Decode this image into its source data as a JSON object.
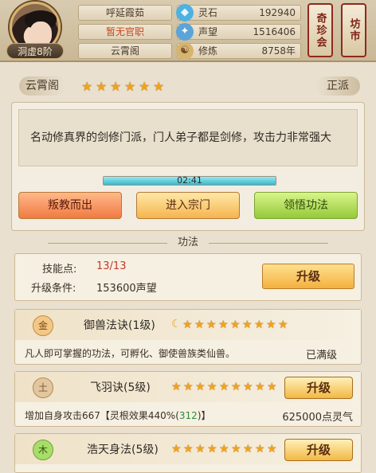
{
  "player": {
    "avatar_icon": "cultivator-avatar",
    "realm": "洞虚8阶",
    "name": "呼延霞茹",
    "official_title": "暂无官职",
    "sect": "云霄阁"
  },
  "resources": [
    {
      "icon": "spirit-stone-icon",
      "label": "灵石",
      "value": "192940"
    },
    {
      "icon": "fame-icon",
      "label": "声望",
      "value": "1516406"
    },
    {
      "icon": "cultivation-icon",
      "label": "修炼",
      "value": "8758年"
    }
  ],
  "side_buttons": {
    "treasure": "奇珍会",
    "market": "坊市"
  },
  "sect_panel": {
    "name": "云霄阁",
    "stars": 6,
    "alignment": "正派",
    "description": "名动修真界的剑修门派，门人弟子都是剑修，攻击力非常强大",
    "timer": "02:41",
    "timer_progress": 1.0,
    "buttons": {
      "betray": "叛教而出",
      "enter": "进入宗门",
      "enlighten": "领悟功法"
    }
  },
  "gongfa": {
    "section_title": "功法",
    "skill_points_label": "技能点:",
    "skill_points_value": "13/13",
    "upgrade_condition_label": "升级条件:",
    "upgrade_condition_value": "153600声望",
    "upgrade_button": "升级",
    "skills": [
      {
        "element": "金",
        "name": "御兽法诀(1级)",
        "stars": 9,
        "has_moon": true,
        "description": "凡人即可掌握的功法，可孵化、御使兽族类仙兽。",
        "status": "已满级"
      },
      {
        "element": "土",
        "name": "飞羽诀(5级)",
        "stars": 9,
        "has_moon": false,
        "description_prefix": "增加自身攻击667【灵根效果440%(",
        "description_highlight": "312",
        "description_suffix": ")】",
        "cost": "625000点灵气",
        "upgrade_button": "升级"
      },
      {
        "element": "木",
        "name": "浩天身法(5级)",
        "stars": 9,
        "has_moon": false,
        "upgrade_button": "升级"
      }
    ]
  },
  "colors": {
    "accent_red": "#c5471f",
    "star": "#f0a21f",
    "highlight_green": "#2e8b3a"
  }
}
